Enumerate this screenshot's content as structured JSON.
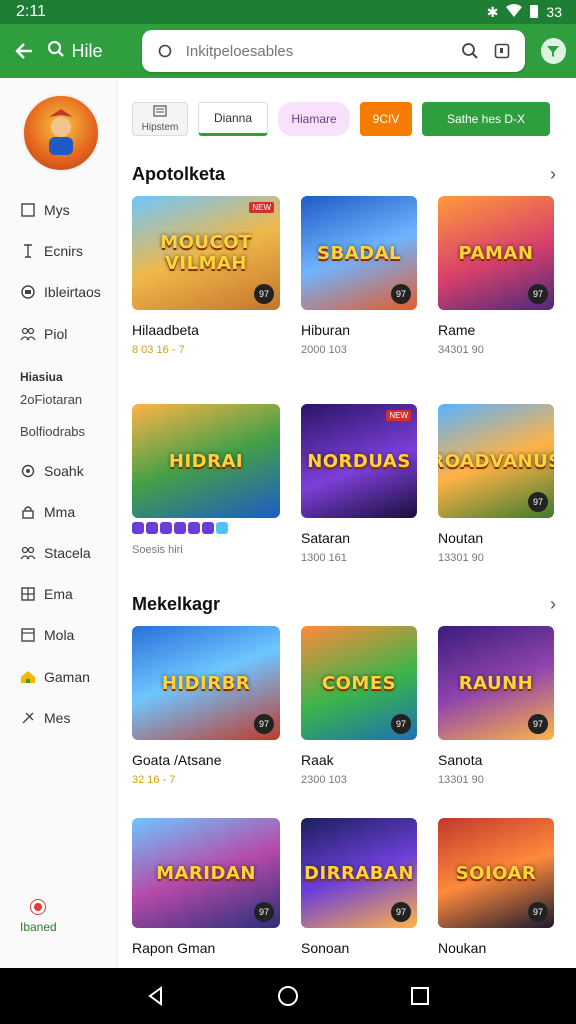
{
  "status": {
    "time": "2:11",
    "right_text": "33"
  },
  "appbar": {
    "title": "Hile",
    "search_placeholder": "Inkitpeloesables"
  },
  "chips": [
    {
      "label": "Hipstem"
    },
    {
      "label": "Dianna"
    },
    {
      "label": "Hiamare"
    },
    {
      "label": "9CIV"
    },
    {
      "label": "Sathe hes  D-X"
    }
  ],
  "sidebar": {
    "items": [
      {
        "label": "Mys",
        "icon": "square-icon"
      },
      {
        "label": "Ecnirs",
        "icon": "tool-icon"
      },
      {
        "label": "Ibleirtaos",
        "icon": "chip-icon"
      },
      {
        "label": "Piol",
        "icon": "people-icon"
      }
    ],
    "heading": "Hiasiua",
    "plain": [
      "2oFiotaran",
      "Bolfiodrabs"
    ],
    "items2": [
      {
        "label": "Soahk",
        "icon": "gear-icon"
      },
      {
        "label": "Mma",
        "icon": "lock-icon"
      },
      {
        "label": "Stacela",
        "icon": "people-icon"
      },
      {
        "label": "Ema",
        "icon": "grid-icon"
      },
      {
        "label": "Mola",
        "icon": "window-icon"
      },
      {
        "label": "Gaman",
        "icon": "home-icon"
      },
      {
        "label": "Mes",
        "icon": "tools-icon"
      }
    ],
    "bottom_label": "Ibaned"
  },
  "sections": [
    {
      "title": "Apotolketa"
    },
    {
      "title": "Mekelkagr"
    }
  ],
  "cards": [
    {
      "logo": "MOUCOT VILMAH",
      "name": "Hilaadbeta",
      "meta": "8  03  16 - 7",
      "badge": "97",
      "tag": "NEW"
    },
    {
      "logo": "SBADAL",
      "name": "Hiburan",
      "meta": "2000 103",
      "badge": "97"
    },
    {
      "logo": "PAMAN",
      "name": "Rame",
      "meta": "34301 90",
      "badge": "97"
    },
    {
      "logo": "HIDRAI",
      "name": "",
      "meta": "Soesis hiri",
      "badge": ""
    },
    {
      "logo": "NORDUAS",
      "name": "Sataran",
      "meta": "1300 161",
      "badge": "",
      "tag": "NEW"
    },
    {
      "logo": "ROADVANUS",
      "name": "Noutan",
      "meta": "13301 90",
      "badge": "97"
    },
    {
      "logo": "HIDIRBR",
      "name": "Goata /Atsane",
      "meta": "32  16 - 7",
      "badge": "97"
    },
    {
      "logo": "COMES",
      "name": "Raak",
      "meta": "2300 103",
      "badge": "97"
    },
    {
      "logo": "RAUNH",
      "name": "Sanota",
      "meta": "13301 90",
      "badge": "97"
    },
    {
      "logo": "MARIDAN",
      "name": "Rapon Gman",
      "meta": "",
      "badge": "97"
    },
    {
      "logo": "DIRRABAN",
      "name": "Sonoan",
      "meta": "",
      "badge": "97"
    },
    {
      "logo": "SOIOAR",
      "name": "Noukan",
      "meta": "",
      "badge": "97"
    }
  ],
  "colors": {
    "primary": "#2e9e3e",
    "status_bar": "#1e7e34",
    "accent_orange": "#f57c00"
  }
}
